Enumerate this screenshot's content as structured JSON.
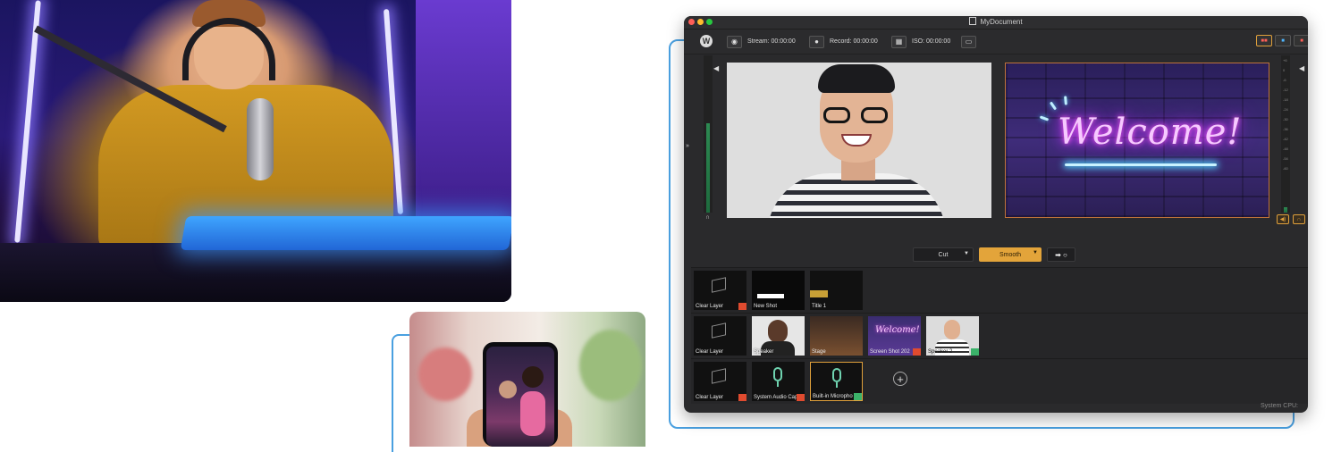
{
  "window": {
    "title": "MyDocument"
  },
  "toolbar": {
    "stream_label": "Stream:",
    "stream_time": "00:00:00",
    "record_label": "Record:",
    "record_time": "00:00:00",
    "iso_label": "ISO:",
    "iso_time": "00:00:00"
  },
  "icons": {
    "logo": "wirecast-logo-icon",
    "stream": "broadcast-icon",
    "record": "record-icon",
    "iso": "clapperboard-icon",
    "screen": "monitor-icon",
    "add": "plus-icon"
  },
  "meter_scale": [
    "+6",
    "0",
    "-6",
    "-12",
    "-18",
    "-24",
    "-30",
    "-36",
    "-42",
    "-48",
    "-54",
    "-60"
  ],
  "live_preview": {
    "welcome_text": "Welcome!"
  },
  "transitions": {
    "cut_label": "Cut",
    "smooth_label": "Smooth",
    "go_glyph": "➡ ○"
  },
  "shot_rows": [
    {
      "shots": [
        {
          "label": "Clear Layer",
          "badge": "#e04b2f"
        },
        {
          "label": "New Shot",
          "badge": ""
        },
        {
          "label": "Title 1",
          "badge": ""
        }
      ]
    },
    {
      "shots": [
        {
          "label": "Clear Layer",
          "badge": ""
        },
        {
          "label": "Speaker",
          "badge": ""
        },
        {
          "label": "Stage",
          "badge": ""
        },
        {
          "label": "Screen Shot 202",
          "badge": "#e04b2f"
        },
        {
          "label": "Speaker 2",
          "badge": "#3bb36a"
        }
      ]
    },
    {
      "shots": [
        {
          "label": "Clear Layer",
          "badge": "#e04b2f"
        },
        {
          "label": "System Audio Captu",
          "badge": "#e04b2f"
        },
        {
          "label": "Built-in Micropho",
          "badge": "#3bb36a"
        }
      ]
    }
  ],
  "status": {
    "cpu_label": "System CPU:"
  },
  "colors": {
    "accent": "#e3a43a",
    "connector": "#4aa0e0",
    "window_bg": "#2a2a2c"
  }
}
